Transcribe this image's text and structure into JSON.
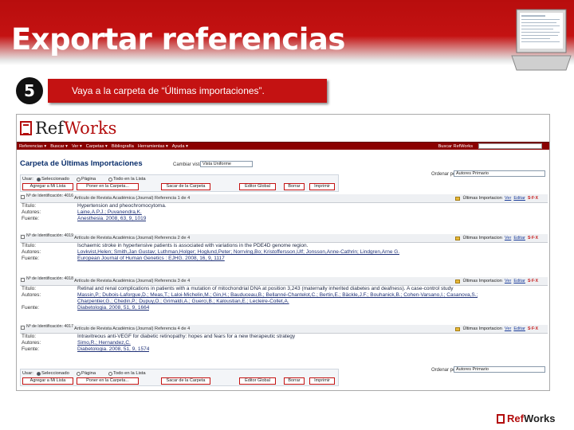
{
  "slide": {
    "title": "Exportar referencias",
    "step_number": "5",
    "step_text": "Vaya a  la carpeta de “Últimas importaciones”."
  },
  "logo": {
    "ref": "Ref",
    "works": "Works"
  },
  "menu": [
    "Referencias ▾",
    "Buscar ▾",
    "Ver ▾",
    "Carpetas ▾",
    "Bibliografía",
    "Herramientas ▾",
    "Ayuda ▾"
  ],
  "search_label": "Buscar RefWorks",
  "page": {
    "folder_title": "Carpeta de Últimas Importaciones",
    "change_view_label": "Cambiar vista",
    "view_value": "Vista Uniforme",
    "order_label": "Ordenar por",
    "order_value": "Autores Primario"
  },
  "toolbar": {
    "use_label": "Usar:",
    "radios": [
      "Seleccionado",
      "Página",
      "Todo en la Lista"
    ],
    "buttons": [
      "Agregar a Mi Lista",
      "Poner en la Carpeta...",
      "Sacar de la Carpeta",
      "Editor Global",
      "Borrar",
      "Imprimir"
    ]
  },
  "records": [
    {
      "id_label": "Nº de Identificación: 4016",
      "type": "Artículo de Revista Académica (Journal) Referencia 1 de 4",
      "folder": "Últimas Importacion",
      "ver": "Ver",
      "editar": "Editar",
      "sfx": "S·F·X",
      "fields": [
        {
          "k": "Título:",
          "v": "Hypertension and pheochromocytoma."
        },
        {
          "k": "Autores:",
          "v": "Laine,A.P.J.; Puvanendra,K."
        },
        {
          "k": "Fuente:",
          "v": "Anesthesia. 2008, 63, 9, 1019"
        }
      ]
    },
    {
      "id_label": "Nº de Identificación: 4019",
      "type": "Artículo de Revista Académica (Journal) Referencia 2 de 4",
      "folder": "Últimas Importacion",
      "ver": "Ver",
      "editar": "Editar",
      "sfx": "S·F·X",
      "fields": [
        {
          "k": "Título:",
          "v": "Ischaemic stroke in hypertensive patients is associated with variations in the PDE4D genome region."
        },
        {
          "k": "Autores:",
          "v": "Lovkvist,Helen; Smith,Jan Gustav; Luthman,Holger; Hoglund,Peter; Norrving,Bo; Kristoffersson,Ulf; Jonsson,Anne-Cathrin; Lindgren,Arne G."
        },
        {
          "k": "Fuente:",
          "v": "European Journal of Human Genetics : EJHG. 2008, 16, 9, 1117"
        }
      ]
    },
    {
      "id_label": "Nº de Identificación: 4018",
      "type": "Artículo de Revista Académica (Journal) Referencia 3 de 4",
      "folder": "Últimas Importacion",
      "ver": "Ver",
      "editar": "Editar",
      "sfx": "S·F·X",
      "fields": [
        {
          "k": "Título:",
          "v": "Retinal and renal complications in patients with a mutation of mitochondrial DNA at position 3,243 (maternally inherited diabetes and deafness). A case-control study"
        },
        {
          "k": "Autores:",
          "v": "Massin,P.; Dubois-Laforgue,D.; Meas,T.; Laloi-Michelin,M.; Gin,H.; Bauduceau,B.; Bellanné-Chantelot,C.; Bertin,E.; Bäckle,J.F.; Bouhanick,B.; Cohen-Varsano,I.; Casanova,S.;"
        },
        {
          "k": "",
          "v": "Charpentier,G.; Chedin,P.; Dupuy,O.; Grimaldi,A.; Guerci,B.; Kaloustian,E.; Lecleire-Collet,A."
        },
        {
          "k": "Fuente:",
          "v": "Diabetologia. 2008, 51, 9, 1664"
        }
      ]
    },
    {
      "id_label": "Nº de Identificación: 4017",
      "type": "Artículo de Revista Académica (Journal) Referencia 4 de 4",
      "folder": "Últimas Importacion",
      "ver": "Ver",
      "editar": "Editar",
      "sfx": "S·F·X",
      "fields": [
        {
          "k": "Título:",
          "v": "Intravitreous anti-VEGF for diabetic retinopathy: hopes and fears for a new therapeutic strategy"
        },
        {
          "k": "Autores:",
          "v": "Simo,R.; Hernandez,C."
        },
        {
          "k": "Fuente:",
          "v": "Diabetologia. 2008, 51, 9, 1574"
        }
      ]
    }
  ],
  "footer_logo": {
    "ref": "Ref",
    "works": "Works"
  }
}
